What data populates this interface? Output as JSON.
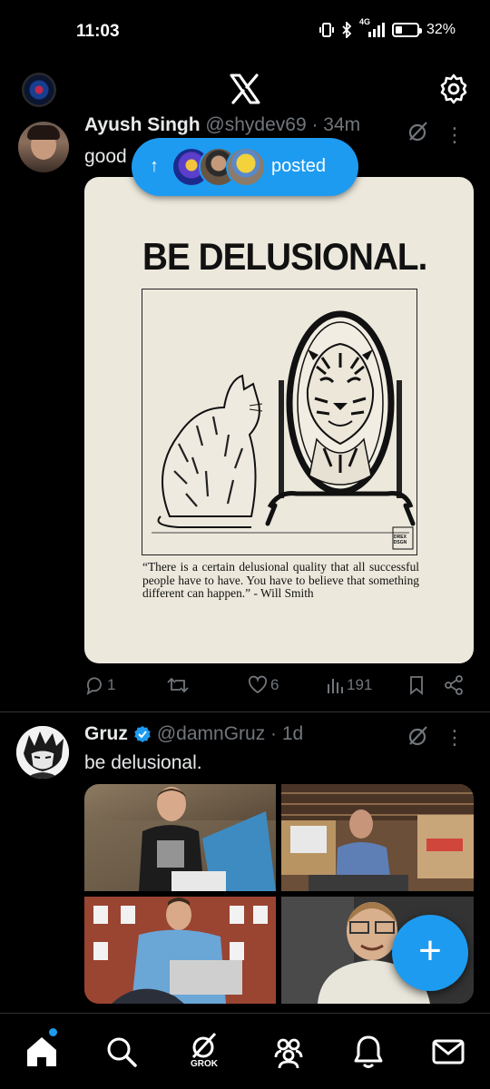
{
  "status_bar": {
    "time": "11:03",
    "network": "4G",
    "battery_percent": "32%",
    "battery_level": 0.32
  },
  "topbar": {
    "logo_icon": "x-logo-icon",
    "settings_icon": "gear-icon"
  },
  "posted_pill": {
    "arrow": "↑",
    "label": "posted"
  },
  "tweet1": {
    "name": "Ayush Singh",
    "handle": "@shydev69 · 34m",
    "text": "good",
    "poster": {
      "title": "BE DELUSIONAL.",
      "quote": "“There is a certain delusional quality that all successful people have to have. You have to believe that something different can happen.” - Will Smith",
      "watermark": "DREX DSGN"
    },
    "actions": {
      "replies": "1",
      "reposts": "",
      "likes": "6",
      "views": "191"
    }
  },
  "tweet2": {
    "name": "Gruz",
    "handle": "@damnGruz · 1d",
    "text": "be delusional."
  },
  "fab": {
    "label": "+"
  },
  "bottom_nav": {
    "grok_label": "GROK"
  },
  "colors": {
    "accent": "#1d9bf0",
    "background": "#000000",
    "secondary_text": "#71767b"
  }
}
